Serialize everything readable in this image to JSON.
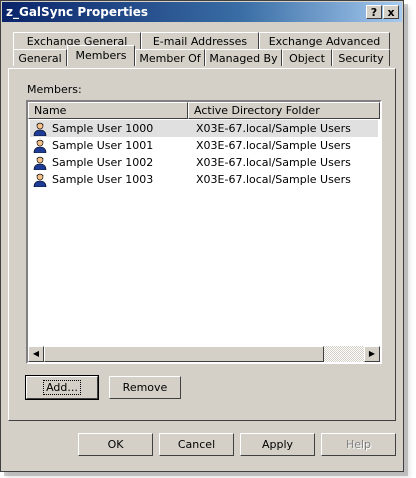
{
  "window": {
    "title": "z_GalSync Properties",
    "help_btn": "?",
    "close_btn": "x"
  },
  "tabs": {
    "back_row": [
      "Exchange General",
      "E-mail Addresses",
      "Exchange Advanced"
    ],
    "front_row": [
      "General",
      "Members",
      "Member Of",
      "Managed By",
      "Object",
      "Security"
    ],
    "active": "Members"
  },
  "members": {
    "label": "Members:",
    "columns": {
      "name": "Name",
      "folder": "Active Directory Folder"
    },
    "rows": [
      {
        "name": "Sample User 1000",
        "folder": "X03E-67.local/Sample Users"
      },
      {
        "name": "Sample User 1001",
        "folder": "X03E-67.local/Sample Users"
      },
      {
        "name": "Sample User 1002",
        "folder": "X03E-67.local/Sample Users"
      },
      {
        "name": "Sample User 1003",
        "folder": "X03E-67.local/Sample Users"
      }
    ],
    "add_label": "Add...",
    "remove_label": "Remove"
  },
  "footer": {
    "ok": "OK",
    "cancel": "Cancel",
    "apply": "Apply",
    "help": "Help"
  },
  "icons": {
    "user": "user-icon",
    "scroll_left": "arrow-left-icon",
    "scroll_right": "arrow-right-icon"
  }
}
